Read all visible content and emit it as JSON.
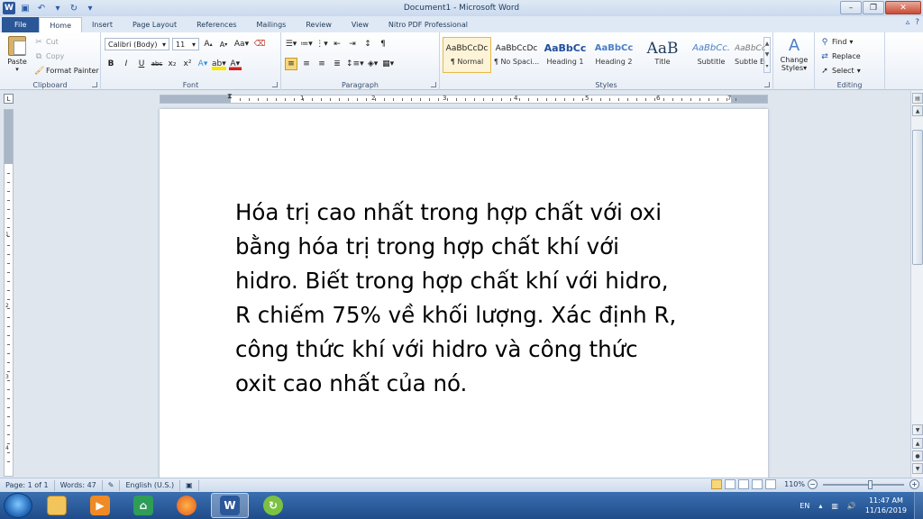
{
  "window": {
    "title": "Document1 - Microsoft Word"
  },
  "quick_access": {
    "save_icon": "save-icon",
    "undo_icon": "undo-icon",
    "redo_icon": "redo-icon"
  },
  "tabs": [
    {
      "label": "File"
    },
    {
      "label": "Home"
    },
    {
      "label": "Insert"
    },
    {
      "label": "Page Layout"
    },
    {
      "label": "References"
    },
    {
      "label": "Mailings"
    },
    {
      "label": "Review"
    },
    {
      "label": "View"
    },
    {
      "label": "Nitro PDF Professional"
    }
  ],
  "ribbon": {
    "clipboard": {
      "label": "Clipboard",
      "paste": "Paste",
      "cut": "Cut",
      "copy": "Copy",
      "format_painter": "Format Painter"
    },
    "font": {
      "label": "Font",
      "font_name": "Calibri (Body)",
      "font_size": "11",
      "case_label": "Aa",
      "bold": "B",
      "italic": "I",
      "underline": "U",
      "strike": "abc",
      "subscript": "x₂",
      "superscript": "x²"
    },
    "paragraph": {
      "label": "Paragraph",
      "pilcrow": "¶"
    },
    "styles": {
      "label": "Styles",
      "items": [
        {
          "sample": "AaBbCcDc",
          "name": "¶ Normal"
        },
        {
          "sample": "AaBbCcDc",
          "name": "¶ No Spaci..."
        },
        {
          "sample": "AaBbCc",
          "name": "Heading 1"
        },
        {
          "sample": "AaBbCc",
          "name": "Heading 2"
        },
        {
          "sample": "AaB",
          "name": "Title"
        },
        {
          "sample": "AaBbCc.",
          "name": "Subtitle"
        },
        {
          "sample": "AaBbCcDc",
          "name": "Subtle Em..."
        }
      ],
      "change_styles_line1": "Change",
      "change_styles_line2": "Styles"
    },
    "editing": {
      "label": "Editing",
      "find": "Find",
      "replace": "Replace",
      "select": "Select"
    }
  },
  "ruler": {
    "numbers": [
      "1",
      "2",
      "3",
      "4",
      "5",
      "6",
      "7"
    ]
  },
  "document": {
    "lines": [
      "Hóa trị cao nhất trong hợp chất với oxi",
      "bằng hóa trị trong hợp chất khí với",
      "hidro. Biết trong hợp chất khí với hidro,",
      "R chiếm 75% về khối lượng. Xác định R,",
      "công thức khí với hidro và công thức",
      "oxit cao nhất của nó."
    ]
  },
  "status": {
    "page": "Page: 1 of 1",
    "words": "Words: 47",
    "language": "English (U.S.)",
    "zoom": "110%"
  },
  "taskbar": {
    "lang": "EN",
    "time": "11:47 AM",
    "date": "11/16/2019"
  },
  "colors": {
    "file_tab": "#2b5797",
    "accent": "#2b579a",
    "taskbar": "#1f4c8a"
  }
}
